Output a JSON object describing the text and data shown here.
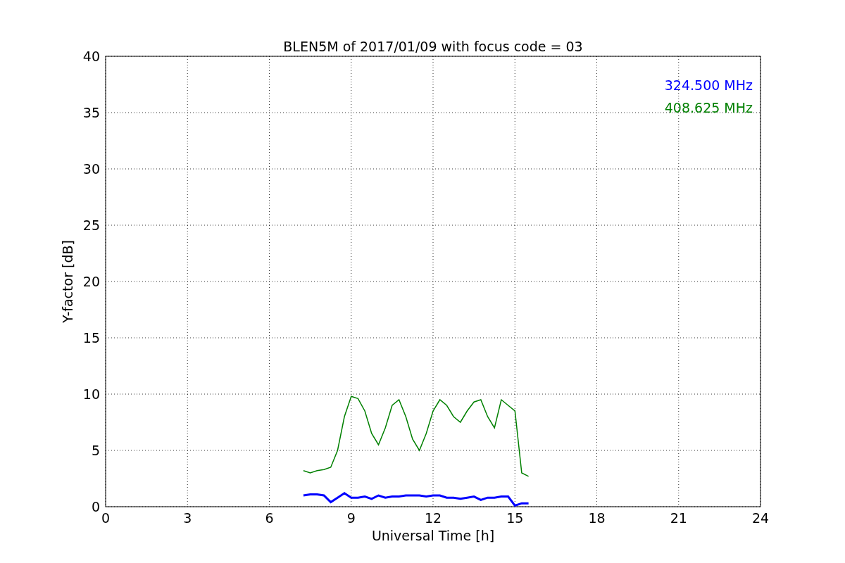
{
  "chart_data": {
    "type": "line",
    "title": "BLEN5M of 2017/01/09 with focus code = 03",
    "xlabel": "Universal Time [h]",
    "ylabel": "Y-factor [dB]",
    "x": [
      7.25,
      7.5,
      7.75,
      8.0,
      8.25,
      8.5,
      8.75,
      9.0,
      9.25,
      9.5,
      9.75,
      10.0,
      10.25,
      10.5,
      10.75,
      11.0,
      11.25,
      11.5,
      11.75,
      12.0,
      12.25,
      12.5,
      12.75,
      13.0,
      13.25,
      13.5,
      13.75,
      14.0,
      14.25,
      14.5,
      14.75,
      15.0,
      15.25,
      15.5
    ],
    "series": [
      {
        "name": "324.500 MHz",
        "color": "#0000ff",
        "values": [
          1.0,
          1.1,
          1.1,
          1.0,
          0.4,
          0.8,
          1.2,
          0.8,
          0.8,
          0.9,
          0.7,
          1.0,
          0.8,
          0.9,
          0.9,
          1.0,
          1.0,
          1.0,
          0.9,
          1.0,
          1.0,
          0.8,
          0.8,
          0.7,
          0.8,
          0.9,
          0.6,
          0.8,
          0.8,
          0.9,
          0.9,
          0.1,
          0.3,
          0.3
        ]
      },
      {
        "name": "408.625 MHz",
        "color": "#008000",
        "values": [
          3.2,
          3.0,
          3.2,
          3.3,
          3.5,
          5.0,
          8.0,
          9.8,
          9.6,
          8.5,
          6.5,
          5.5,
          7.0,
          9.0,
          9.5,
          8.0,
          6.0,
          5.0,
          6.5,
          8.5,
          9.5,
          9.0,
          8.0,
          7.5,
          8.5,
          9.3,
          9.5,
          8.0,
          7.0,
          9.5,
          9.0,
          8.5,
          3.0,
          2.7
        ]
      }
    ],
    "grid": true,
    "xlim": [
      0,
      24
    ],
    "ylim": [
      0,
      40
    ],
    "xticks": [
      0,
      3,
      6,
      9,
      12,
      15,
      18,
      21,
      24
    ],
    "yticks": [
      0,
      5,
      10,
      15,
      20,
      25,
      30,
      35,
      40
    ]
  }
}
